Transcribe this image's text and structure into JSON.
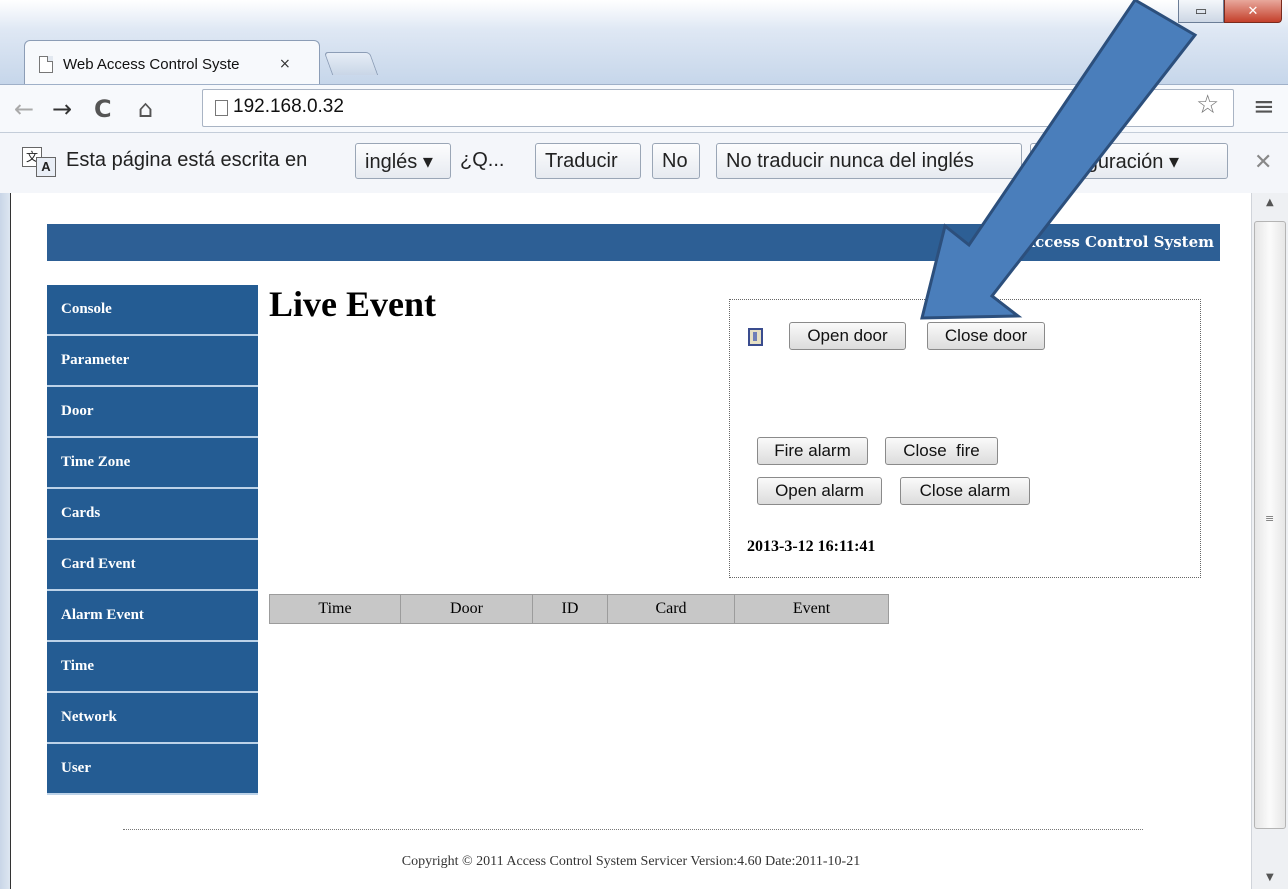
{
  "browser": {
    "tab_title": "Web Access Control Syste",
    "tab_close": "×",
    "url": "192.168.0.32",
    "nav": {
      "back": "←",
      "forward": "→",
      "reload": "C",
      "home": "⌂"
    },
    "icons": {
      "bookmark": "star-icon",
      "menu": "hamburger-menu-icon"
    }
  },
  "translate_bar": {
    "text": "Esta página está escrita en",
    "language_button": "inglés ▾",
    "question": "¿Q...",
    "translate_button": "Traducir",
    "no_button": "No",
    "never_button": "No traducir nunca del inglés",
    "config_button": "Configuración ▾",
    "close": "✕"
  },
  "page": {
    "banner_title": "Access Control System",
    "heading": "Live Event",
    "sidebar": [
      {
        "label": "Console"
      },
      {
        "label": "Parameter"
      },
      {
        "label": "Door"
      },
      {
        "label": "Time Zone"
      },
      {
        "label": "Cards"
      },
      {
        "label": "Card Event"
      },
      {
        "label": "Alarm Event"
      },
      {
        "label": "Time"
      },
      {
        "label": "Network"
      },
      {
        "label": "User"
      }
    ],
    "control_panel": {
      "open_door": "Open door",
      "close_door": "Close door",
      "fire_alarm": "Fire alarm",
      "close_fire": "Close  fire",
      "open_alarm": "Open alarm",
      "close_alarm": "Close alarm",
      "datetime": "2013-3-12 16:11:41"
    },
    "table": {
      "columns": [
        "Time",
        "Door",
        "ID",
        "Card",
        "Event"
      ]
    },
    "footer": "Copyright © 2011 Access Control System Servicer Version:4.60 Date:2011-10-21"
  },
  "colors": {
    "nav_blue": "#245c93",
    "banner_blue": "#2d5f95",
    "arrow_fill": "#4a7ebb",
    "arrow_stroke": "#2c4f7c"
  }
}
